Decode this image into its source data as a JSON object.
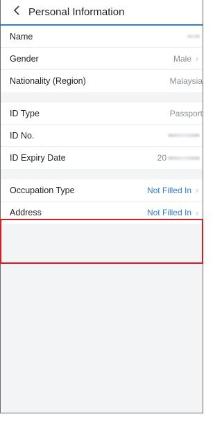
{
  "header": {
    "title": "Personal Information"
  },
  "groups": [
    [
      {
        "label": "Name",
        "value": ""
      },
      {
        "label": "Gender",
        "value": "Male"
      },
      {
        "label": "Nationality (Region)",
        "value": "Malaysia"
      }
    ],
    [
      {
        "label": "ID Type",
        "value": "Passport"
      },
      {
        "label": "ID No.",
        "value": ""
      },
      {
        "label": "ID Expiry Date",
        "value": "20"
      }
    ],
    [
      {
        "label": "Occupation Type",
        "value": "Not Filled In"
      },
      {
        "label": "Address",
        "value": "Not Filled In"
      }
    ]
  ],
  "colors": {
    "accent": "#2f7fd6",
    "highlight": "#e0191e"
  },
  "icons": {
    "back": "chevron-left-icon",
    "row_arrow": "chevron-right-icon"
  }
}
